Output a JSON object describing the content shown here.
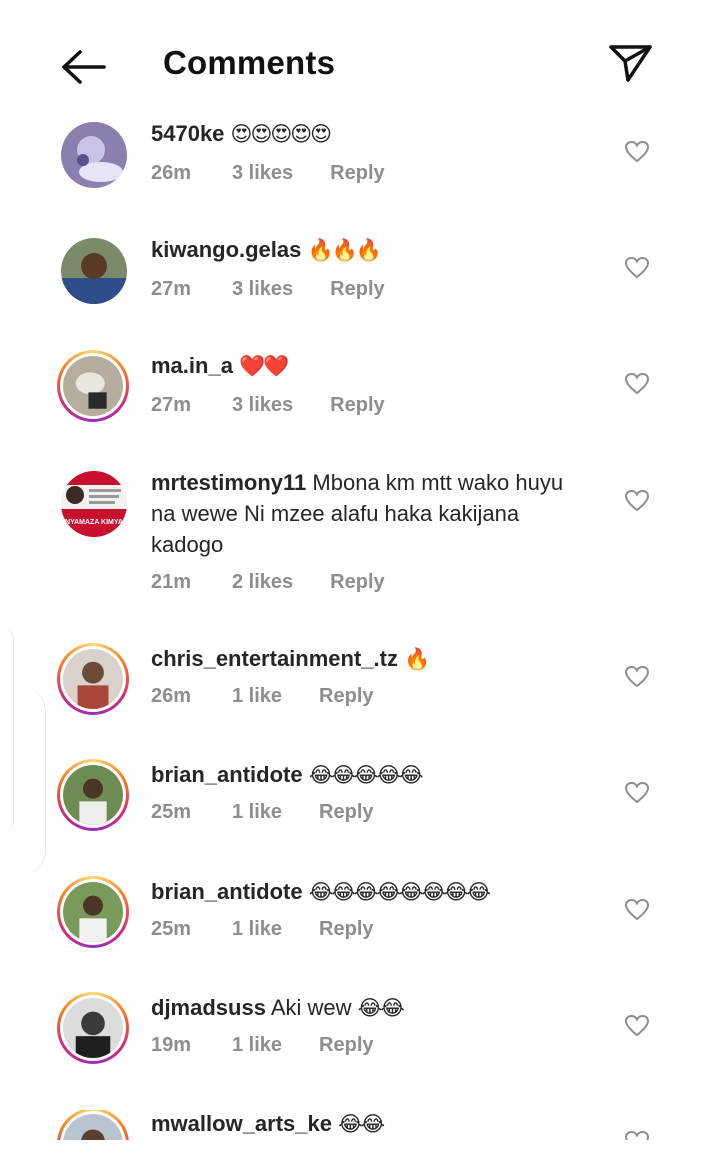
{
  "header": {
    "title": "Comments",
    "back_icon": "arrow-left-icon",
    "share_icon": "paper-plane-icon"
  },
  "colors": {
    "text_primary": "#262626",
    "text_secondary": "#8e8e8e",
    "story_ring": "#d62976"
  },
  "comments": [
    {
      "username": "5470ke",
      "text": "",
      "emoji": "😍😍😍😍😍",
      "time": "26m",
      "likes": "3 likes",
      "reply": "Reply"
    },
    {
      "username": "kiwango.gelas",
      "text": "",
      "emoji": "🔥🔥🔥",
      "time": "27m",
      "likes": "3 likes",
      "reply": "Reply"
    },
    {
      "username": "ma.in_a",
      "text": "",
      "emoji": "❤️❤️",
      "time": "27m",
      "likes": "3 likes",
      "reply": "Reply"
    },
    {
      "username": "mrtestimony11",
      "text": "Mbona km mtt wako huyu na wewe Ni mzee alafu haka kakijana kadogo",
      "emoji": "",
      "time": "21m",
      "likes": "2 likes",
      "reply": "Reply",
      "avatar_text": "NYAMAZA KIMYA"
    },
    {
      "username": "chris_entertainment_.tz",
      "text": "",
      "emoji": "🔥",
      "time": "26m",
      "likes": "1 like",
      "reply": "Reply"
    },
    {
      "username": "brian_antidote",
      "text": "",
      "emoji": "😂😂😂😂😂",
      "time": "25m",
      "likes": "1 like",
      "reply": "Reply"
    },
    {
      "username": "brian_antidote",
      "text": "",
      "emoji": "😂😂😂😂😂😂😂😂",
      "time": "25m",
      "likes": "1 like",
      "reply": "Reply"
    },
    {
      "username": "djmadsuss",
      "text": "Aki wew",
      "emoji": "😂😂",
      "time": "19m",
      "likes": "1 like",
      "reply": "Reply"
    },
    {
      "username": "mwallow_arts_ke",
      "text": "",
      "emoji": "😂😂",
      "time": "",
      "likes": "",
      "reply": ""
    }
  ]
}
